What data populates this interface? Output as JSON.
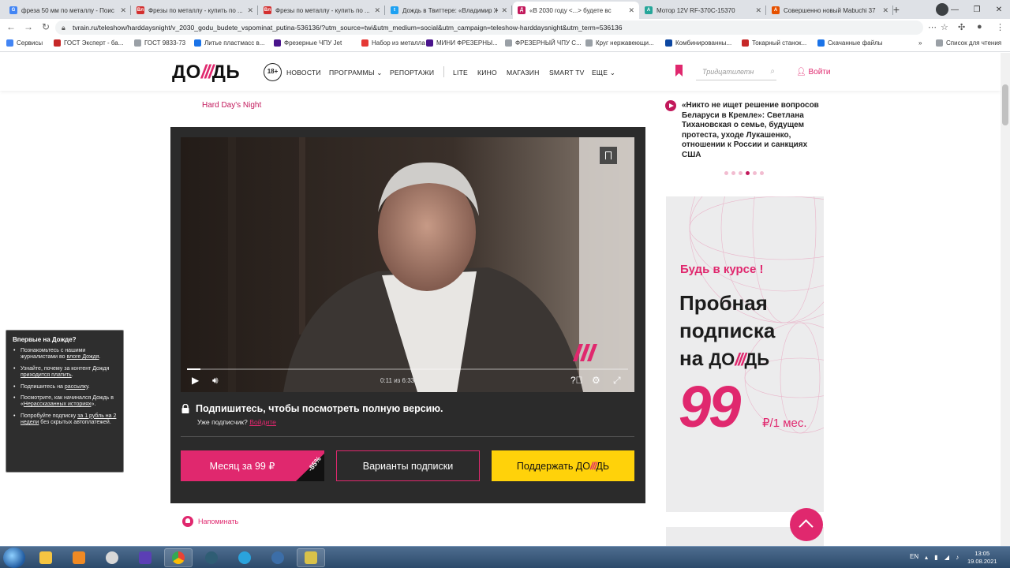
{
  "browser": {
    "tabs": [
      {
        "title": "фреза 50 мм по металлу - Поис",
        "favicon": "G",
        "color": "#4285f4",
        "active": false
      },
      {
        "title": "Фрезы по металлу - купить по ...",
        "favicon": "Вл",
        "color": "#d32f2f",
        "active": false
      },
      {
        "title": "Фрезы по металлу - купить по ...",
        "favicon": "Вл",
        "color": "#d32f2f",
        "active": false
      },
      {
        "title": "Дождь в Твиттере: «Владимир Ж",
        "favicon": "t",
        "color": "#1da1f2",
        "active": false
      },
      {
        "title": "«В 2030 году <...> будете вс",
        "favicon": "Д",
        "color": "#c2185b",
        "active": true
      },
      {
        "title": "Мотор 12V RF-370C-15370",
        "favicon": "А",
        "color": "#26a69a",
        "active": false
      },
      {
        "title": "Совершенно новый Mabuchi 37",
        "favicon": "А",
        "color": "#e65100",
        "active": false
      }
    ],
    "url": "tvrain.ru/teleshow/harddaysnight/v_2030_godu_budete_vspominat_putina-536136/?utm_source=twi&utm_medium=social&utm_campaign=teleshow-harddaysnight&utm_term=536136",
    "bookmarks": [
      "Сервисы",
      "ГОСТ Эксперт - ба...",
      "ГОСТ 9833-73",
      "Литье пластмасс в...",
      "Фрезерные ЧПУ Jet",
      "Набор из металла",
      "МИНИ ФРЕЗЕРНЫ...",
      "ФРЕЗЕРНЫЙ ЧПУ С...",
      "Круг нержавеющи...",
      "Комбинированны...",
      "Токарный станок...",
      "Скачанные файлы"
    ],
    "reading_list": "Список для чтения"
  },
  "site": {
    "logo_left": "ДО",
    "logo_slashes": "///",
    "logo_right": "ДЬ",
    "age": "18+",
    "nav": [
      "НОВОСТИ",
      "ПРОГРАММЫ",
      "РЕПОРТАЖИ",
      "LITE",
      "КИНО",
      "МАГАЗИН",
      "SMART TV",
      "ЕЩЕ"
    ],
    "search_placeholder": "Тридцатилетн",
    "login": "Войти"
  },
  "show": {
    "name": "Hard Day's Night"
  },
  "player": {
    "time": "0:11 из 6:33",
    "progress": 0.03,
    "lock_text": "Подпишитесь, чтобы посмотреть полную версию.",
    "subscriber_text": "Уже подписчик?",
    "login_link": "Войдите",
    "btn_month": "Месяц за 99 ₽",
    "discount": "-85%",
    "btn_variants": "Варианты подписки",
    "btn_support_left": "Поддержать ДО",
    "btn_support_slashes": "///",
    "btn_support_right": "ДЬ"
  },
  "remind": "Напоминать",
  "news": {
    "text": "«Никто не ищет решение вопросов Беларуси в Кремле»: Светлана Тихановская о семье, будущем протеста, уходе Лукашенко, отношении к России и санкциях США",
    "dots": 6,
    "active_dot": 3
  },
  "ad": {
    "kicker": "Будь в курсе !",
    "line1": "Пробная",
    "line2": "подписка",
    "line3_prefix": "на ",
    "logo_left": "ДО",
    "logo_slashes": "///",
    "logo_right": "ДЬ",
    "price": "99",
    "unit": "₽/1 мес."
  },
  "popup": {
    "title": "Впервые на Дожде?",
    "items": [
      {
        "text": "Познакомьтесь с нашими журналистами во ",
        "link": "влоге Дождя",
        "tail": "."
      },
      {
        "text": "Узнайте, почему за контент Дождя ",
        "link": "приходится платить",
        "tail": "."
      },
      {
        "text": "Подпишитесь на ",
        "link": "рассылку",
        "tail": "."
      },
      {
        "text": "Посмотрите, как начинался Дождь в «",
        "link": "Нерассказанных историях",
        "tail": "»."
      },
      {
        "text": "Попробуйте подписку ",
        "link": "за 1 рубль на 2 недели",
        "tail": " без скрытых автоплатежей."
      }
    ]
  },
  "taskbar": {
    "lang": "EN",
    "time": "13:05",
    "date": "19.08.2021"
  }
}
